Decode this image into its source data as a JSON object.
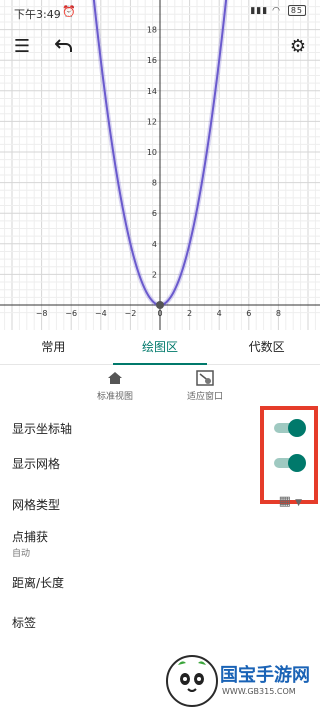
{
  "status_bar": {
    "time": "下午3:49",
    "alarm_icon": "alarm-clock-icon",
    "indicators": "▮▮▮ ▮▮▮ ",
    "battery": "85"
  },
  "toolbar": {
    "menu_icon": "hamburger-menu-icon",
    "undo_icon": "undo-icon",
    "settings_icon": "gear-icon"
  },
  "chart_data": {
    "type": "line",
    "function": "y = x^2",
    "series": [
      {
        "x": [
          -4.5,
          -4,
          -3,
          -2,
          -1,
          0,
          1,
          2,
          3,
          4,
          4.5
        ],
        "y": [
          20.25,
          16,
          9,
          4,
          1,
          0,
          1,
          4,
          9,
          16,
          20.25
        ]
      }
    ],
    "xlim": [
      -10.8,
      10.8
    ],
    "ylim": [
      -0.9,
      20.8
    ],
    "x_ticks": [
      "−8",
      "−6",
      "−4",
      "−2",
      "0",
      "2",
      "4",
      "6",
      "8"
    ],
    "y_ticks": [
      "2",
      "4",
      "6",
      "8",
      "10",
      "12",
      "14",
      "16",
      "18"
    ],
    "grid": true,
    "curve_color": "#6a5acd",
    "origin_point": {
      "x": 0,
      "y": 0
    }
  },
  "tabs": [
    {
      "label": "常用",
      "active": false
    },
    {
      "label": "绘图区",
      "active": true
    },
    {
      "label": "代数区",
      "active": false
    }
  ],
  "view_buttons": [
    {
      "label": "标准视图",
      "icon": "home-icon"
    },
    {
      "label": "适应窗口",
      "icon": "fit-window-icon"
    }
  ],
  "settings": {
    "show_axes": {
      "label": "显示坐标轴",
      "on": true
    },
    "show_grid": {
      "label": "显示网格",
      "on": true
    },
    "grid_type": {
      "label": "网格类型",
      "icon": "grid-icon"
    },
    "point_capture": {
      "label": "点捕获",
      "value": "自动"
    },
    "distance_length": {
      "label": "距离/长度"
    },
    "labels": {
      "label": "标签"
    }
  },
  "accent_color": "#00796b",
  "highlight_color": "#e53c2a",
  "watermark": {
    "text": "国宝手游网",
    "url": "WWW.GB315.COM"
  }
}
